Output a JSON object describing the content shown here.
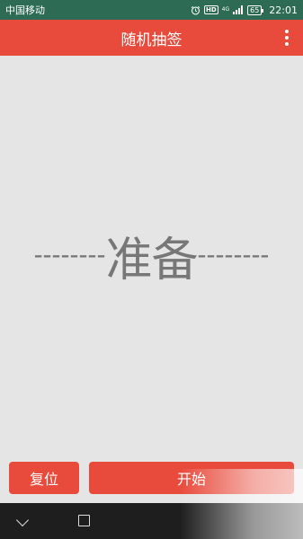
{
  "status_bar": {
    "carrier": "中国移动",
    "hd_badge": "HD",
    "network": "4G",
    "battery": "65",
    "time": "22:01"
  },
  "app_bar": {
    "title": "随机抽签",
    "menu_icon": "more-vert-icon"
  },
  "main": {
    "left_dashes": "--------",
    "result_text": "准备",
    "right_dashes": "--------"
  },
  "buttons": {
    "reset_label": "复位",
    "start_label": "开始"
  },
  "nav_bar": {
    "back_icon": "chevron-down-icon",
    "recent_icon": "square-icon"
  },
  "colors": {
    "status_bar_bg": "#2d6b55",
    "accent": "#e84b3c",
    "background": "#e5e5e5",
    "result_text": "#777777",
    "nav_bar_bg": "#1e1e1e"
  }
}
